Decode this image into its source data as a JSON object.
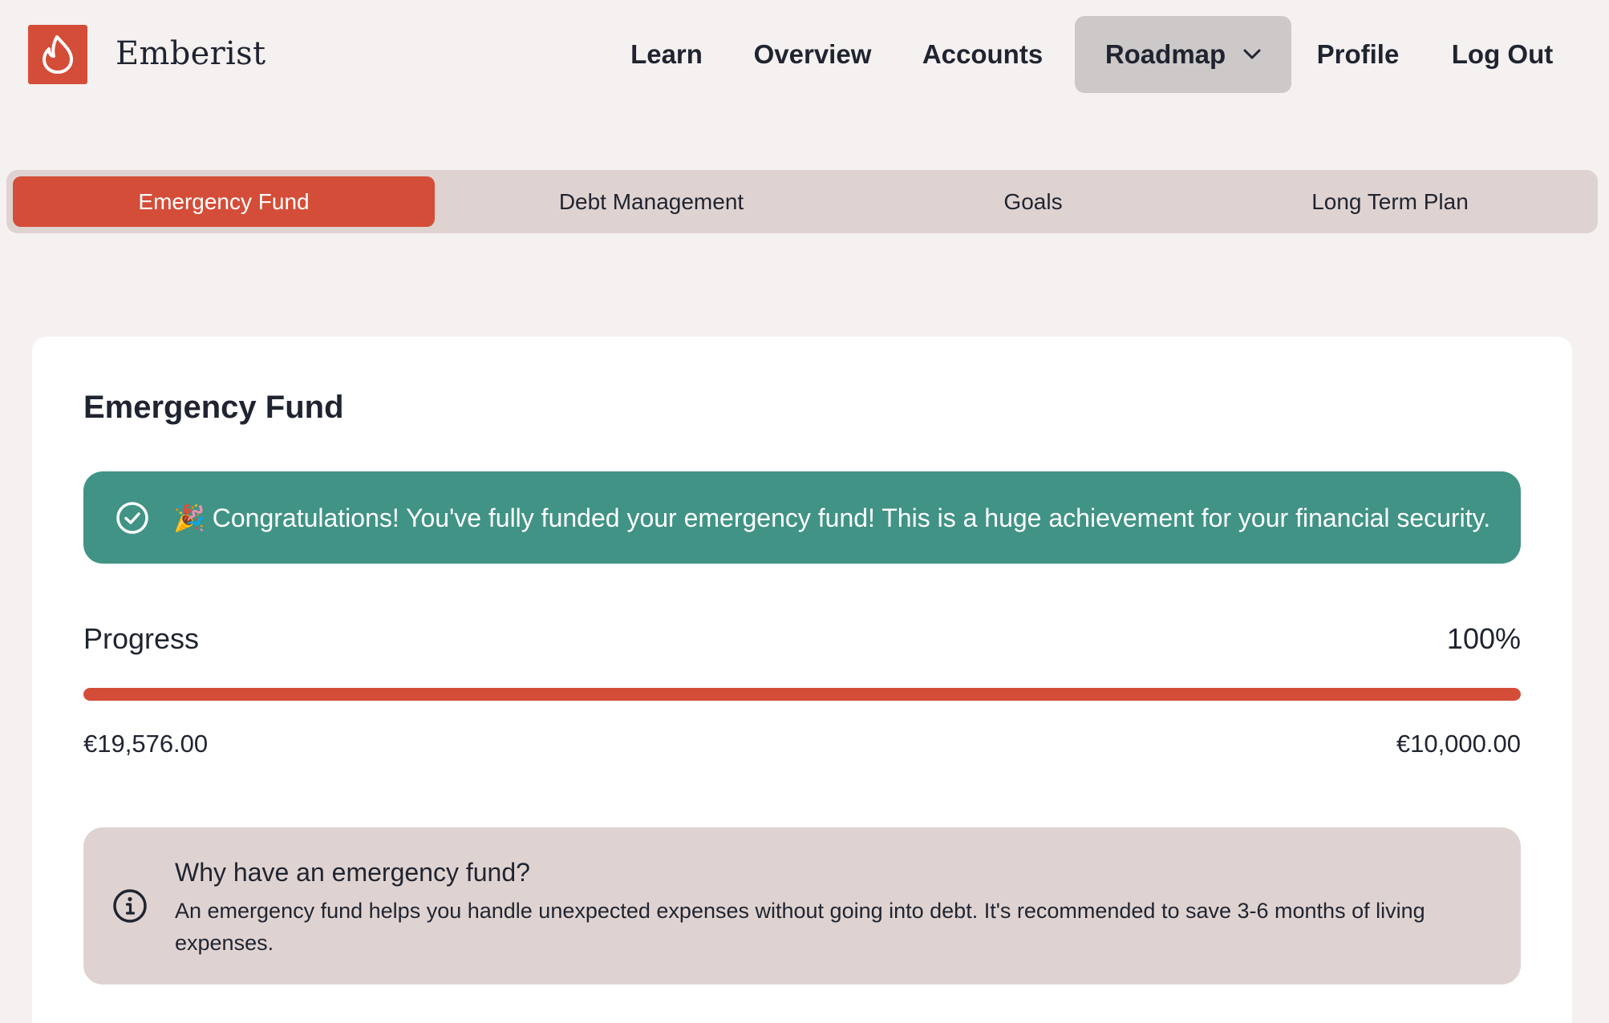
{
  "header": {
    "brand": "Emberist",
    "logo_icon": "flame-icon",
    "nav": [
      {
        "label": "Learn"
      },
      {
        "label": "Overview"
      },
      {
        "label": "Accounts"
      },
      {
        "label": "Roadmap",
        "active": true,
        "has_dropdown": true
      },
      {
        "label": "Profile"
      },
      {
        "label": "Log Out"
      }
    ]
  },
  "tabs": [
    {
      "label": "Emergency Fund",
      "active": true
    },
    {
      "label": "Debt Management"
    },
    {
      "label": "Goals"
    },
    {
      "label": "Long Term Plan"
    }
  ],
  "card": {
    "title": "Emergency Fund",
    "success_message": "🎉 Congratulations! You've fully funded your emergency fund! This is a huge achievement for your financial security.",
    "progress": {
      "label": "Progress",
      "percent_text": "100%",
      "percent": 100,
      "current_amount": "€19,576.00",
      "target_amount": "€10,000.00"
    },
    "info": {
      "title": "Why have an emergency fund?",
      "body": "An emergency fund helps you handle unexpected expenses without going into debt. It's recommended to save 3-6 months of living expenses."
    }
  },
  "colors": {
    "accent": "#d44d38",
    "success": "#419385",
    "info_bg": "#dfd3d1",
    "page_bg": "#f5f1f0"
  }
}
